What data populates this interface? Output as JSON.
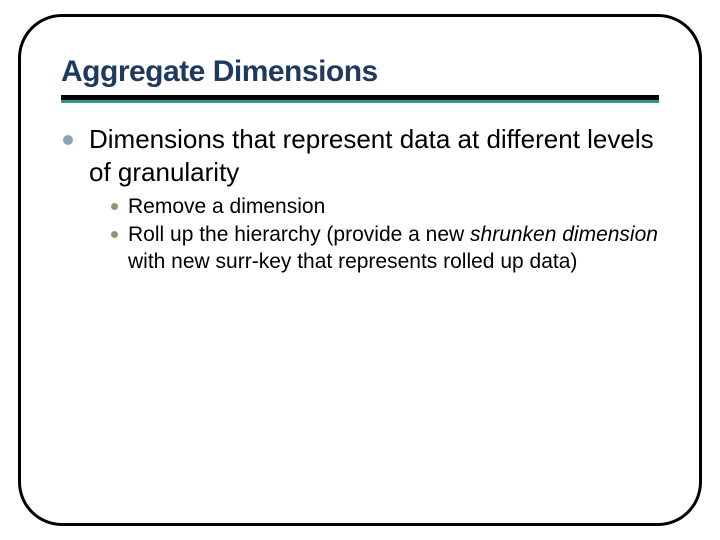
{
  "title": "Aggregate Dimensions",
  "main_point": "Dimensions that represent data at different levels of granularity",
  "sub_points": {
    "a": "Remove a dimension",
    "b_pre": "Roll up the hierarchy (provide a new ",
    "b_italic": "shrunken dimension",
    "b_post": " with new surr-key that represents rolled up data)"
  }
}
